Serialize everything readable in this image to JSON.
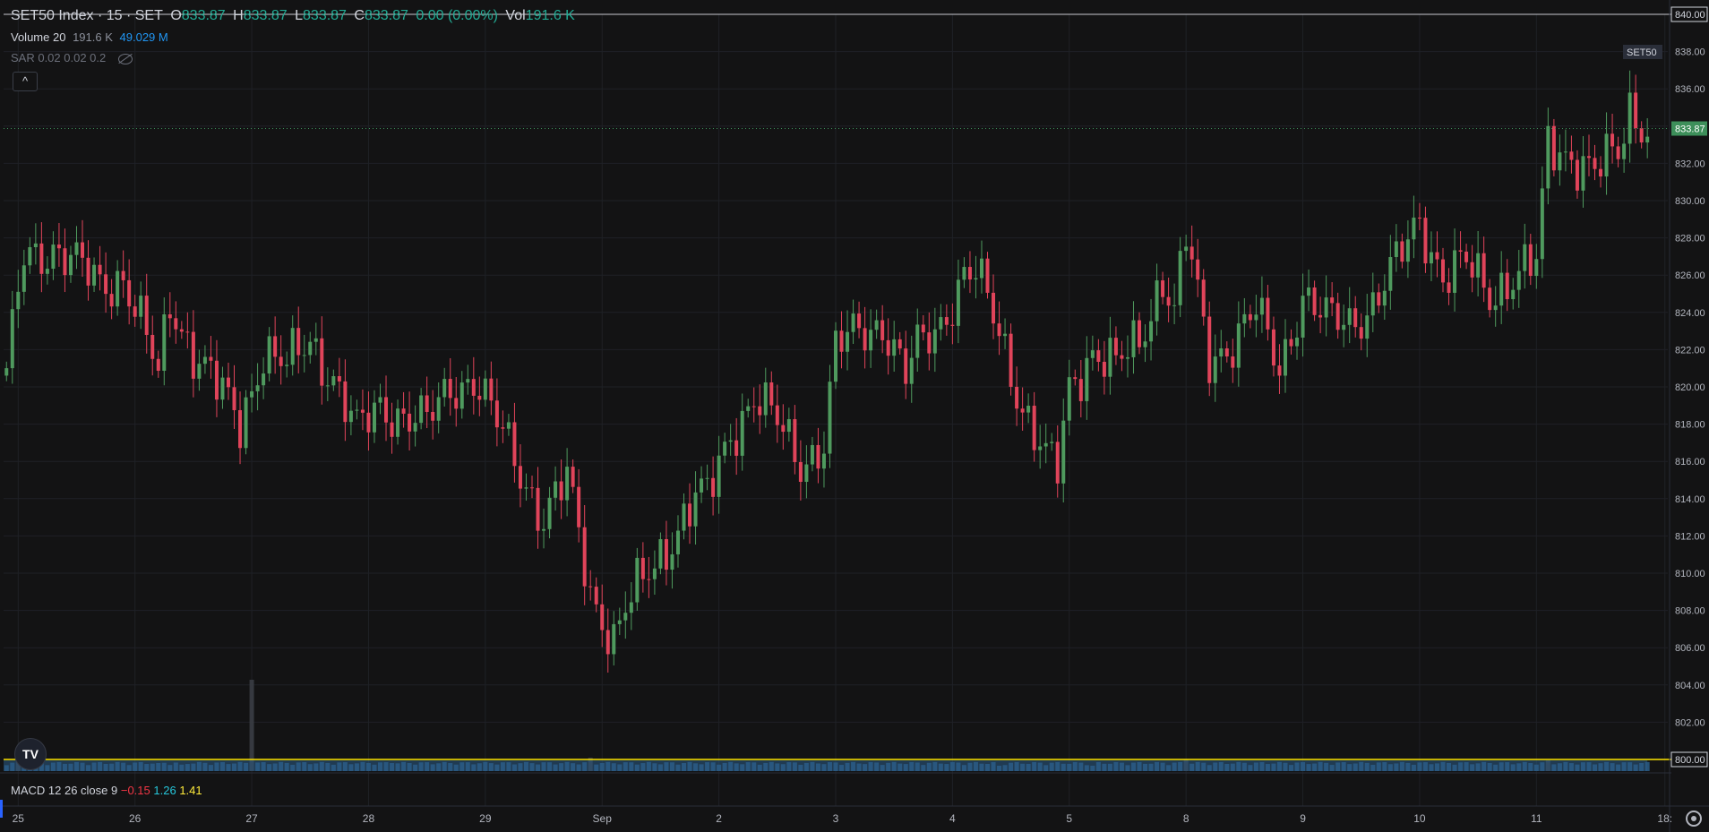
{
  "header": {
    "symbol": "SET50 Index · 15 · SET",
    "o_label": "O",
    "o_value": "833.87",
    "h_label": "H",
    "h_value": "833.87",
    "l_label": "L",
    "l_value": "833.87",
    "c_label": "C",
    "c_value": "833.87",
    "change": "0.00 (0.00%)",
    "vol_label": "Vol",
    "vol_value": "191.6 K"
  },
  "volume_legend": {
    "name": "Volume 20",
    "value1": "191.6 K",
    "value2": "49.029 M"
  },
  "sar_legend": {
    "name": "SAR 0.02 0.02 0.2"
  },
  "collapse_label": "^",
  "logo_text": "TV",
  "macd_legend": {
    "name": "MACD 12 26 close 9",
    "v1": "−0.15",
    "v2": "1.26",
    "v3": "1.41"
  },
  "colors": {
    "up": "#4f9a5e",
    "down": "#e0445a",
    "volume": "#2b5d86",
    "yellow_line": "#ffe600",
    "price_badge": "#3d8f5a"
  },
  "chart_data": {
    "type": "candlestick",
    "title": "SET50 Index · 15 · SET",
    "ylim": [
      800,
      840
    ],
    "y_ticks": [
      "840.00",
      "838.00",
      "836.00",
      "834.00",
      "832.00",
      "830.00",
      "828.00",
      "826.00",
      "824.00",
      "822.00",
      "820.00",
      "818.00",
      "816.00",
      "814.00",
      "812.00",
      "810.00",
      "808.00",
      "806.00",
      "804.00",
      "802.00",
      "800.00"
    ],
    "x_ticks": [
      {
        "label": "25",
        "index": 2
      },
      {
        "label": "26",
        "index": 22
      },
      {
        "label": "27",
        "index": 42
      },
      {
        "label": "28",
        "index": 62
      },
      {
        "label": "29",
        "index": 82
      },
      {
        "label": "Sep",
        "index": 102
      },
      {
        "label": "2",
        "index": 122
      },
      {
        "label": "3",
        "index": 142
      },
      {
        "label": "4",
        "index": 162
      },
      {
        "label": "5",
        "index": 182
      },
      {
        "label": "8",
        "index": 202
      },
      {
        "label": "9",
        "index": 222
      },
      {
        "label": "10",
        "index": 242
      },
      {
        "label": "11",
        "index": 262
      },
      {
        "label": "18:",
        "index": 284
      }
    ],
    "last_price": "833.87",
    "series_tag": "SET50",
    "anchors": [
      [
        0,
        820.5
      ],
      [
        3,
        827
      ],
      [
        8,
        827.5
      ],
      [
        12,
        826.5
      ],
      [
        16,
        825.5
      ],
      [
        20,
        826
      ],
      [
        24,
        822.5
      ],
      [
        26,
        820.5
      ],
      [
        28,
        824.5
      ],
      [
        32,
        822
      ],
      [
        36,
        820
      ],
      [
        40,
        818
      ],
      [
        44,
        822
      ],
      [
        48,
        821
      ],
      [
        52,
        822.5
      ],
      [
        56,
        820.5
      ],
      [
        60,
        817.5
      ],
      [
        64,
        819
      ],
      [
        68,
        818.5
      ],
      [
        72,
        818
      ],
      [
        76,
        820
      ],
      [
        80,
        820.5
      ],
      [
        84,
        818
      ],
      [
        88,
        815.5
      ],
      [
        92,
        813
      ],
      [
        96,
        815
      ],
      [
        100,
        809
      ],
      [
        104,
        806.5
      ],
      [
        106,
        808
      ],
      [
        110,
        810
      ],
      [
        114,
        812
      ],
      [
        118,
        814
      ],
      [
        120,
        814
      ],
      [
        124,
        817.5
      ],
      [
        128,
        819.5
      ],
      [
        132,
        818
      ],
      [
        136,
        816
      ],
      [
        140,
        817
      ],
      [
        142,
        822
      ],
      [
        146,
        823
      ],
      [
        150,
        823.5
      ],
      [
        154,
        820.5
      ],
      [
        156,
        822
      ],
      [
        160,
        823.5
      ],
      [
        164,
        826
      ],
      [
        166,
        826
      ],
      [
        170,
        823
      ],
      [
        174,
        819
      ],
      [
        178,
        816
      ],
      [
        180,
        815.5
      ],
      [
        182,
        820
      ],
      [
        186,
        822
      ],
      [
        190,
        821
      ],
      [
        194,
        822.5
      ],
      [
        198,
        826
      ],
      [
        200,
        824
      ],
      [
        202,
        828
      ],
      [
        206,
        821.5
      ],
      [
        210,
        822.5
      ],
      [
        214,
        824
      ],
      [
        218,
        821
      ],
      [
        222,
        825
      ],
      [
        226,
        823.5
      ],
      [
        230,
        823.5
      ],
      [
        234,
        824.5
      ],
      [
        238,
        826.5
      ],
      [
        242,
        829
      ],
      [
        246,
        826
      ],
      [
        250,
        826.5
      ],
      [
        254,
        825
      ],
      [
        258,
        826
      ],
      [
        262,
        826.5
      ],
      [
        264,
        833
      ],
      [
        268,
        832.5
      ],
      [
        272,
        831.5
      ],
      [
        276,
        832.5
      ],
      [
        278,
        835
      ],
      [
        281,
        834
      ]
    ],
    "volume_ylim": [
      0,
      20
    ],
    "volume_spikes": [
      [
        2,
        4
      ],
      [
        26,
        1.5
      ],
      [
        30,
        1.2
      ],
      [
        42,
        17
      ],
      [
        66,
        1.5
      ],
      [
        100,
        2.5
      ],
      [
        102,
        1.5
      ],
      [
        170,
        1
      ],
      [
        186,
        1
      ],
      [
        202,
        2.2
      ],
      [
        264,
        2
      ],
      [
        280,
        1.5
      ]
    ]
  }
}
